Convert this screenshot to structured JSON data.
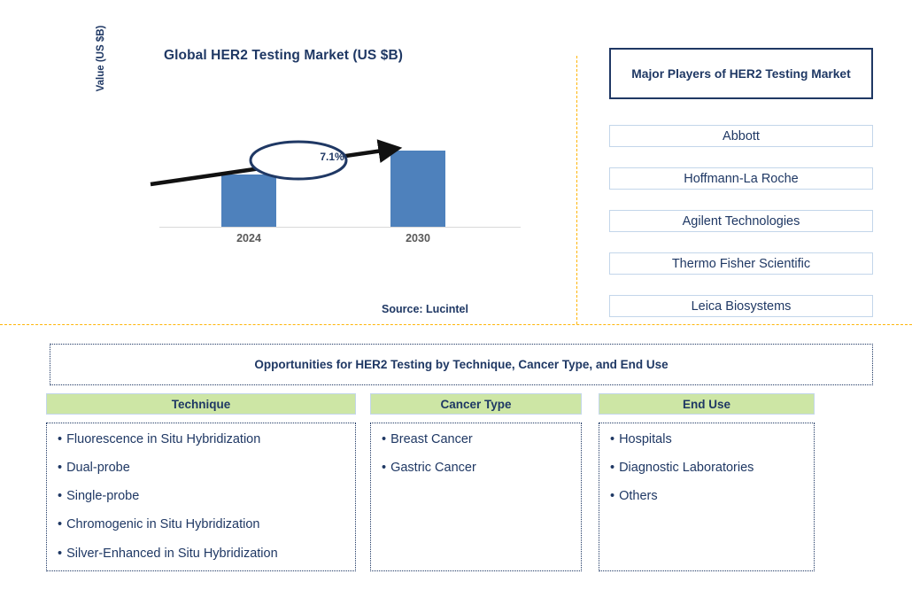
{
  "chart_panel": {
    "title": "Global HER2 Testing Market (US $B)",
    "y_axis_label": "Value (US $B)",
    "cagr_label": "7.1%",
    "source": "Source: Lucintel"
  },
  "chart_data": {
    "type": "bar",
    "title": "Global HER2 Testing Market (US $B)",
    "categories": [
      "2024",
      "2030"
    ],
    "values": [
      59,
      86
    ],
    "value_unit": "relative bar height (US $B, axis unlabeled)",
    "annotation": "7.1%",
    "annotation_meaning": "CAGR 2024-2030",
    "xlabel": "",
    "ylabel": "Value (US $B)",
    "grid": false,
    "legend": "none",
    "bar_color": "#4E81BC",
    "source": "Source: Lucintel"
  },
  "players_panel": {
    "header": "Major Players of HER2 Testing Market",
    "items": [
      {
        "name": "Abbott"
      },
      {
        "name": "Hoffmann-La Roche"
      },
      {
        "name": "Agilent Technologies"
      },
      {
        "name": "Thermo Fisher Scientific"
      },
      {
        "name": "Leica Biosystems"
      }
    ]
  },
  "opportunities": {
    "title": "Opportunities for HER2 Testing by Technique, Cancer Type, and End Use",
    "columns": [
      {
        "header": "Technique",
        "items": [
          "Fluorescence in Situ Hybridization",
          "Dual-probe",
          "Single-probe",
          "Chromogenic in Situ Hybridization",
          "Silver-Enhanced in Situ Hybridization"
        ]
      },
      {
        "header": "Cancer Type",
        "items": [
          "Breast Cancer",
          "Gastric Cancer"
        ]
      },
      {
        "header": "End Use",
        "items": [
          "Hospitals",
          "Diagnostic Laboratories",
          "Others"
        ]
      }
    ]
  },
  "bullet_glyph": "•",
  "colors": {
    "navy_text": "#1F3864",
    "bar_blue": "#4E81BC",
    "header_green": "#CDE6A5",
    "divider_orange": "#FFB60A",
    "box_border_light_blue": "#C3D6EA",
    "tick_gray": "#595959"
  }
}
